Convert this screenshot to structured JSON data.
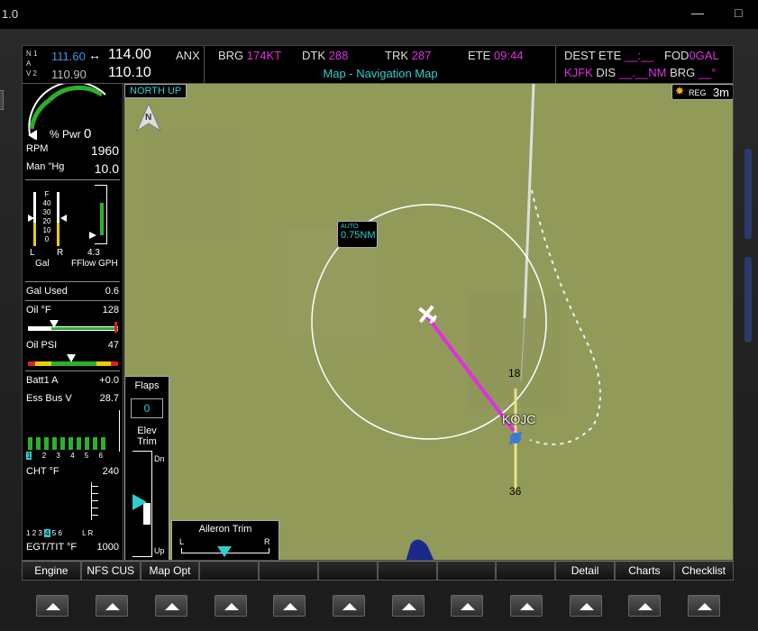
{
  "window": {
    "title": "1.0"
  },
  "nav": {
    "n1_label": "N 1",
    "a_label": "A",
    "v2_label": "V 2",
    "nav1_active": "111.60",
    "nav1_swap": "↔",
    "nav1_standby": "114.00",
    "nav2_active": "110.90",
    "nav2_standby": "110.10",
    "source": "ANX"
  },
  "header": {
    "brg_label": "BRG",
    "brg_value": "174KT",
    "dtk_label": "DTK",
    "dtk_value": "288",
    "trk_label": "TRK",
    "trk_value": "287",
    "ete_label": "ETE",
    "ete_value": "09:44",
    "map_title": "Map - Navigation Map"
  },
  "right": {
    "dest_ete_label": "DEST ETE",
    "dest_ete_value": "__:__",
    "fod_label": "FOD",
    "fod_value": "0GAL",
    "dest": "KJFK",
    "dis_label": "DIS",
    "dis_value": "__.__NM",
    "brg_label": "BRG",
    "brg_value": "__°"
  },
  "eis": {
    "pwr_label": "% Pwr",
    "pwr_value": "0",
    "rpm_label": "RPM",
    "rpm_value": "1960",
    "man_label": "Man \"Hg",
    "man_value": "10.0",
    "fuel_scale": [
      "F",
      "40",
      "30",
      "20",
      "10",
      "0"
    ],
    "fuel_l": "L",
    "fuel_r": "R",
    "fuel_unit": "Gal",
    "fflow_value": "4.3",
    "fflow_label": "FFlow GPH",
    "gal_used_label": "Gal Used",
    "gal_used_value": "0.6",
    "oil_f_label": "Oil °F",
    "oil_f_value": "128",
    "oil_psi_label": "Oil PSI",
    "oil_psi_value": "47",
    "batt_label": "Batt1 A",
    "batt_value": "+0.0",
    "essbus_label": "Ess Bus V",
    "essbus_value": "28.7",
    "cyl_numbers": [
      "1",
      "2",
      "3",
      "4",
      "5",
      "6"
    ],
    "cht_label": "CHT °F",
    "cht_value": "240",
    "egt_cyl_numbers": [
      "1",
      "2",
      "3",
      "4",
      "5",
      "6"
    ],
    "egt_lr": "L R",
    "egt_label": "EGT/TIT °F",
    "egt_value": "1000"
  },
  "trim": {
    "flaps_label": "Flaps",
    "flaps_value": "0",
    "elev_label_1": "Elev",
    "elev_label_2": "Trim",
    "dn_label": "Dn",
    "up_label": "Up",
    "aileron_label": "Aileron Trim",
    "l_label": "L",
    "r_label": "R"
  },
  "map": {
    "orientation": "NORTH UP",
    "north_label": "N",
    "reg_label": "REG",
    "time_label": "3m",
    "range_mode": "AUTO",
    "range_value": "0.75NM",
    "airport": "KOJC",
    "runway_north": "18",
    "runway_south": "36",
    "colors": {
      "map_bg": "#929a5a",
      "course": "#e030e0",
      "runway": "#e8e08a"
    }
  },
  "softkeys": [
    "Engine",
    "NFS CUS",
    "Map Opt",
    "",
    "",
    "",
    "",
    "",
    "",
    "Detail",
    "Charts",
    "Checklist"
  ]
}
